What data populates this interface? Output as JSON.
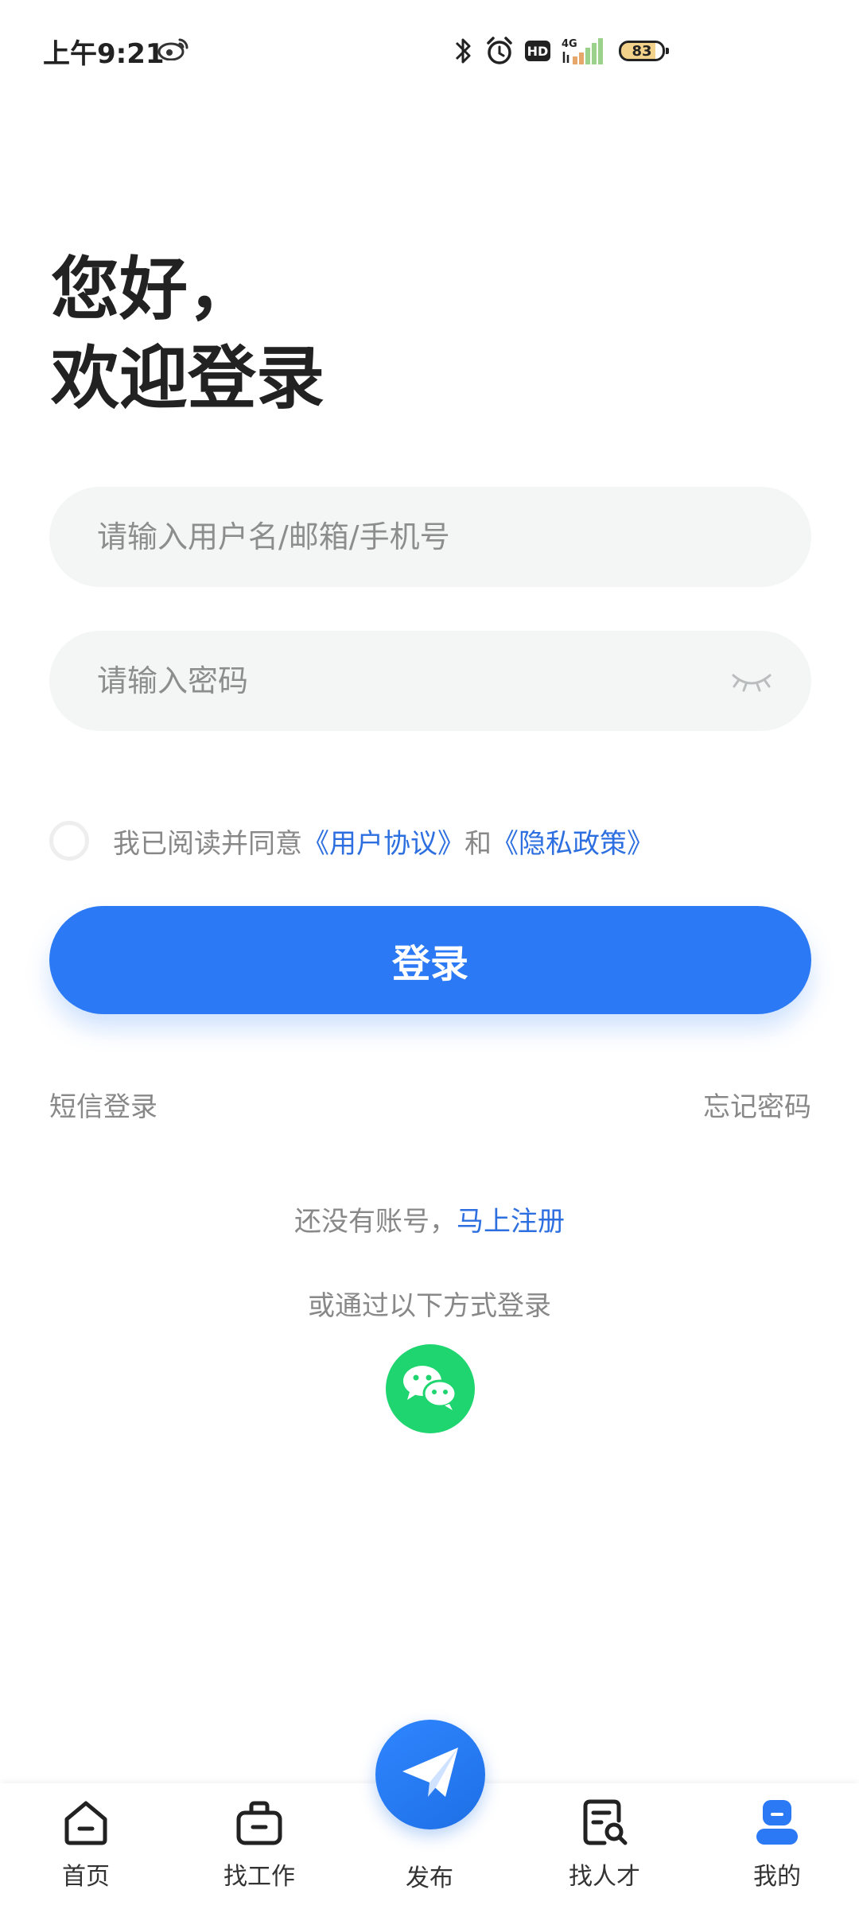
{
  "status_bar": {
    "time": "上午9:21",
    "network": "4G",
    "battery": "83"
  },
  "greeting": {
    "line1": "您好，",
    "line2": "欢迎登录"
  },
  "form": {
    "username_placeholder": "请输入用户名/邮箱/手机号",
    "password_placeholder": "请输入密码"
  },
  "agreement": {
    "prefix": "我已阅读并同意",
    "user_agreement": "《用户协议》",
    "and": "和",
    "privacy_policy": "《隐私政策》"
  },
  "login_button": "登录",
  "links": {
    "sms_login": "短信登录",
    "forgot_password": "忘记密码"
  },
  "register": {
    "prompt": "还没有账号，",
    "link": "马上注册"
  },
  "alt_login": {
    "text": "或通过以下方式登录",
    "icon": "wechat-icon"
  },
  "bottom_nav": {
    "items": [
      {
        "label": "首页",
        "icon": "home-icon"
      },
      {
        "label": "找工作",
        "icon": "briefcase-icon"
      },
      {
        "label": "发布",
        "icon": "paper-plane-icon"
      },
      {
        "label": "找人才",
        "icon": "resume-search-icon"
      },
      {
        "label": "我的",
        "icon": "profile-icon"
      }
    ],
    "active_index": 4
  },
  "colors": {
    "primary": "#2b79f5",
    "link": "#2d6fe0",
    "wechat": "#1ed56f",
    "muted_text": "#888888",
    "input_bg": "#f4f6f6"
  }
}
